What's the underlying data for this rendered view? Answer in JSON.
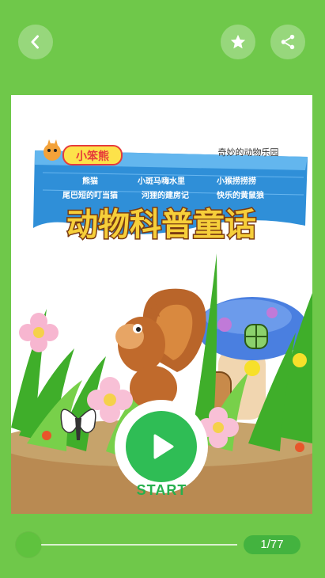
{
  "toolbar": {
    "back_icon": "chevron-left-icon",
    "favorite_icon": "star-icon",
    "share_icon": "share-icon"
  },
  "cover": {
    "brand": "小笨熊",
    "subtitle": "奇妙的动物乐园",
    "stories": [
      "熊猫",
      "小斑马嗨水里",
      "小猴捞捞捞",
      "尾巴短的叮当猫",
      "河狸的建房记",
      "快乐的黄鼠狼"
    ],
    "title": "动物科普童话"
  },
  "player": {
    "start_label": "START",
    "page_indicator": "1/77",
    "progress_fraction": 0.013
  },
  "colors": {
    "background": "#6fc84a",
    "play": "#2fbd55",
    "pill": "#43b33f"
  }
}
